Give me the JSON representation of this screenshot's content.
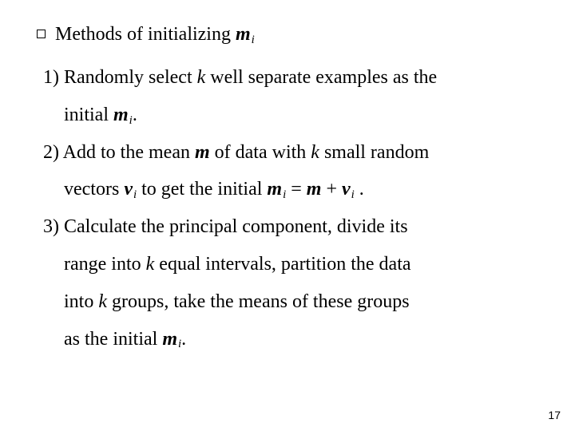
{
  "heading": {
    "text": "Methods of initializing",
    "sym_m": "m",
    "sym_i": "i"
  },
  "items": [
    {
      "lead": "1) ",
      "l1a": "Randomly select ",
      "l1_k": "k",
      "l1b": " well separate examples as the",
      "l2a": "initial  ",
      "l2_m": "m",
      "l2_i": "i",
      "l2b": "."
    },
    {
      "lead": "2) ",
      "l1a": "Add to the mean ",
      "l1_m": "m",
      "l1b": " of data with ",
      "l1_k": "k",
      "l1c": " small random",
      "l2a": "vectors  ",
      "l2_v": "v",
      "l2_i": "i",
      "l2b": " to get the initial  ",
      "eq_m": "m",
      "eq_i1": "i",
      "eq_eq": " = ",
      "eq_m2": "m",
      "eq_plus": " + ",
      "eq_v": "v",
      "eq_i2": "i",
      "l2c": " ."
    },
    {
      "lead": "3) ",
      "l1": "Calculate the principal component, divide its",
      "l2a": "range into ",
      "l2_k": "k",
      "l2b": " equal intervals, partition the data",
      "l3a": "into ",
      "l3_k": "k",
      "l3b": " groups, take the means of these groups",
      "l4a": "as the initial  ",
      "l4_m": "m",
      "l4_i": "i",
      "l4b": "."
    }
  ],
  "page": "17"
}
